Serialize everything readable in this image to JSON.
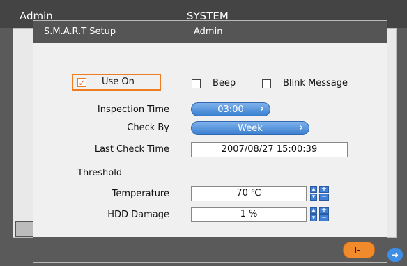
{
  "background_window": {
    "title_left": "Admin",
    "title_center": "SYSTEM",
    "next_icon": "arrow-right-icon"
  },
  "dialog": {
    "title": "S.M.A.R.T Setup",
    "user": "Admin",
    "use_on": {
      "label": "Use On",
      "checked": true
    },
    "beep": {
      "label": "Beep",
      "checked": false
    },
    "blink_message": {
      "label": "Blink Message",
      "checked": false
    },
    "inspection_time": {
      "label": "Inspection Time",
      "value": "03:00"
    },
    "check_by": {
      "label": "Check By",
      "value": "Week"
    },
    "last_check_time": {
      "label": "Last Check Time",
      "value": "2007/08/27 15:00:39"
    },
    "threshold_label": "Threshold",
    "temperature": {
      "label": "Temperature",
      "value": "70 ℃"
    },
    "hdd_damage": {
      "label": "HDD Damage",
      "value": "1 %"
    },
    "save_icon": "save-icon"
  },
  "colors": {
    "accent_orange": "#ee7d22",
    "button_blue": "#3a7fd0",
    "titlebar": "#555555"
  }
}
